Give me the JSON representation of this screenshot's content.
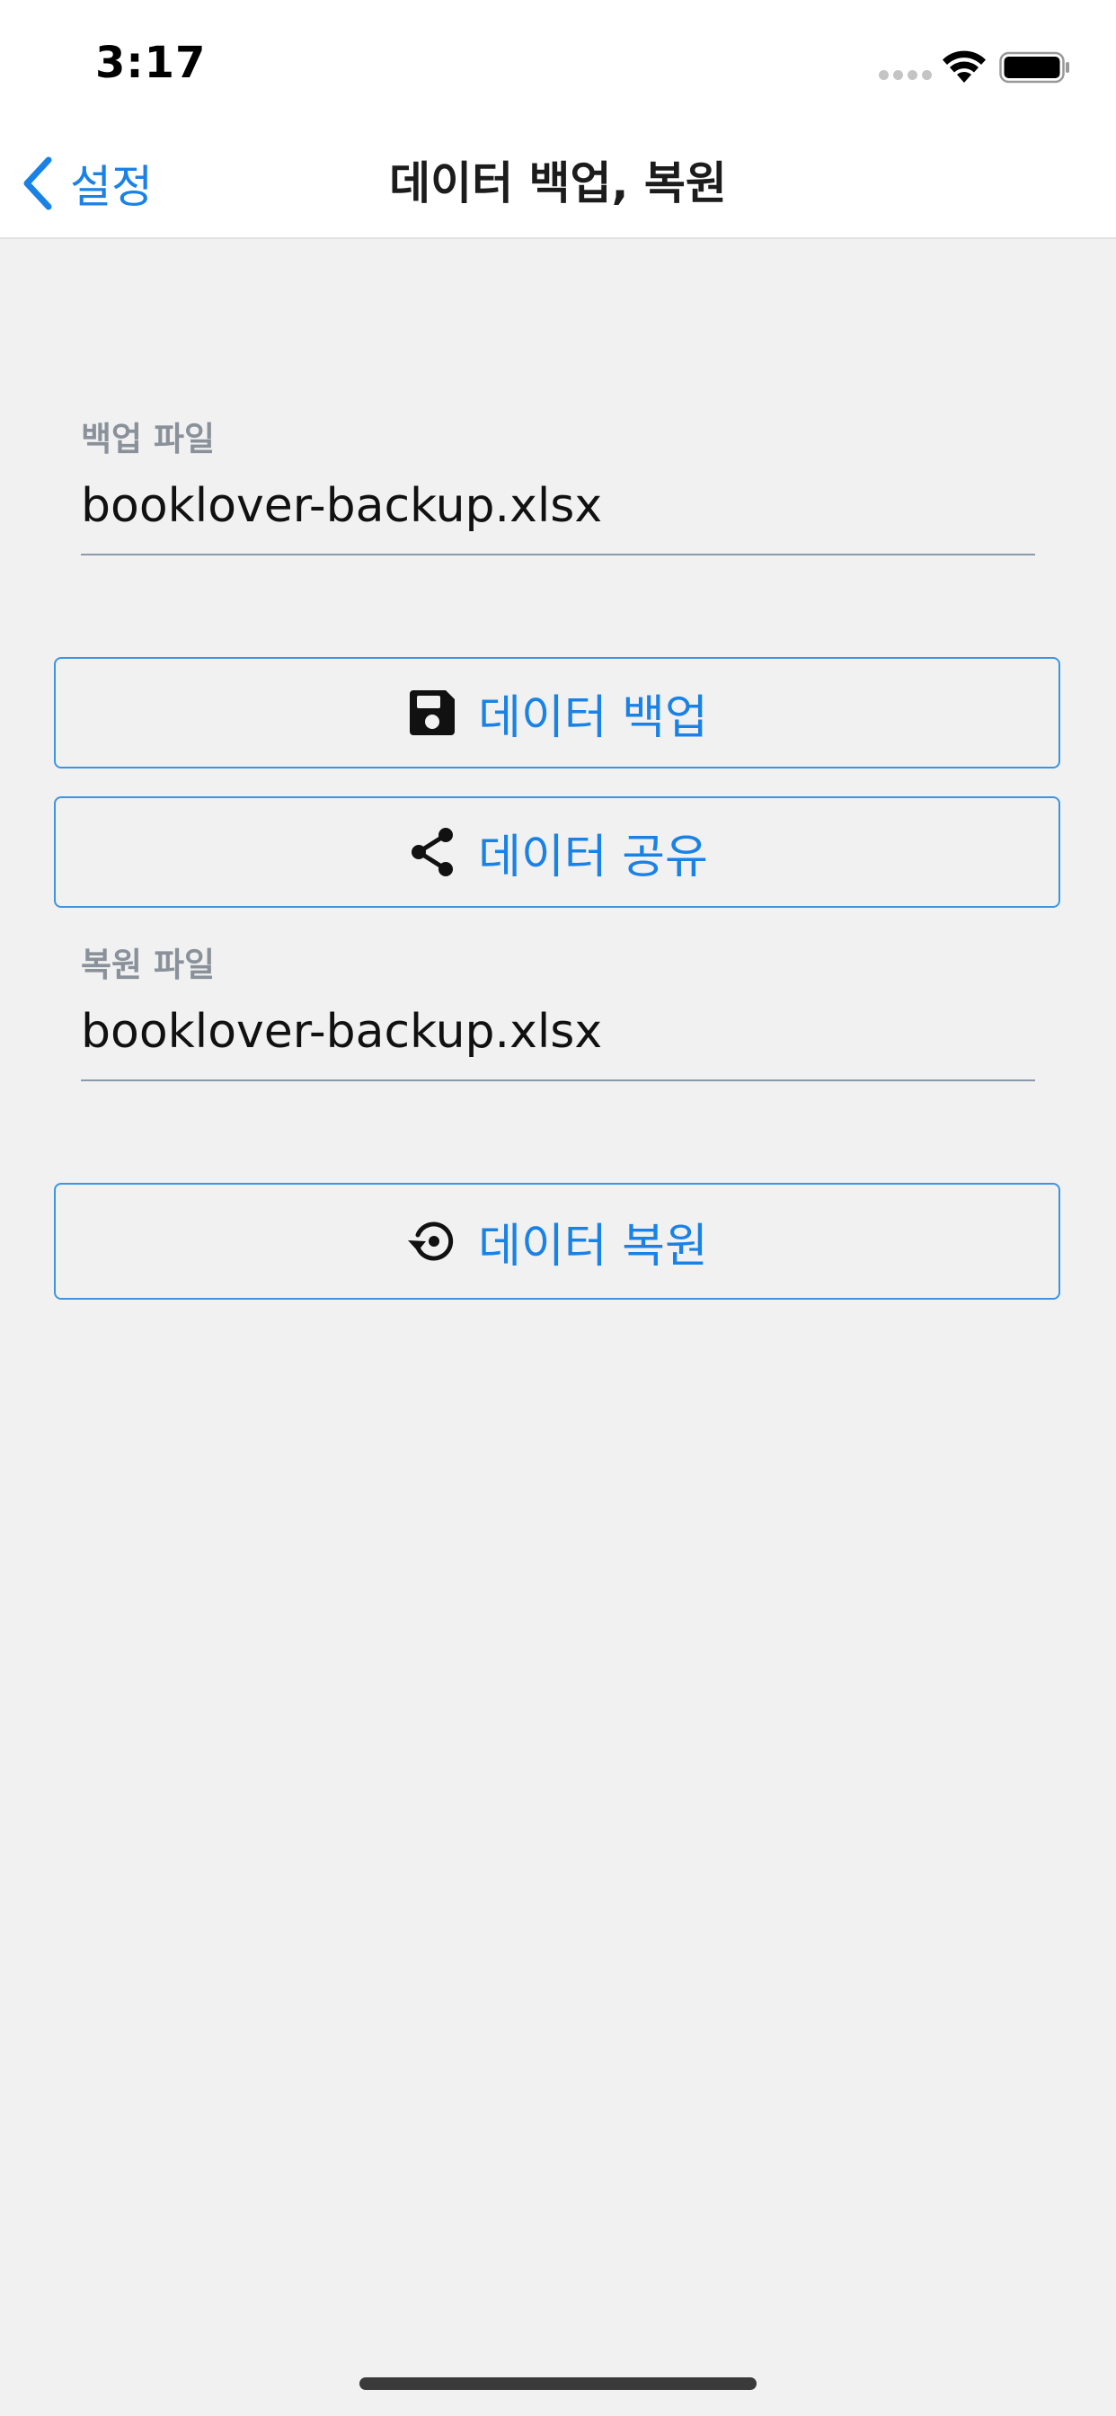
{
  "status_bar": {
    "time": "3:17"
  },
  "nav": {
    "back_label": "설정",
    "title": "데이터 백업, 복원"
  },
  "backup_field": {
    "label": "백업 파일",
    "value": "booklover-backup.xlsx"
  },
  "buttons": {
    "backup_label": "데이터 백업",
    "share_label": "데이터 공유",
    "restore_label": "데이터 복원"
  },
  "restore_field": {
    "label": "복원 파일",
    "value": "booklover-backup.xlsx"
  },
  "icons": {
    "back": "chevron-left-icon",
    "backup": "floppy-disk-icon",
    "share": "share-icon",
    "restore": "history-icon"
  },
  "colors": {
    "accent": "#1a82e6",
    "button_border": "#3c95e3",
    "background": "#f1f1f1",
    "label": "#8a919a"
  }
}
